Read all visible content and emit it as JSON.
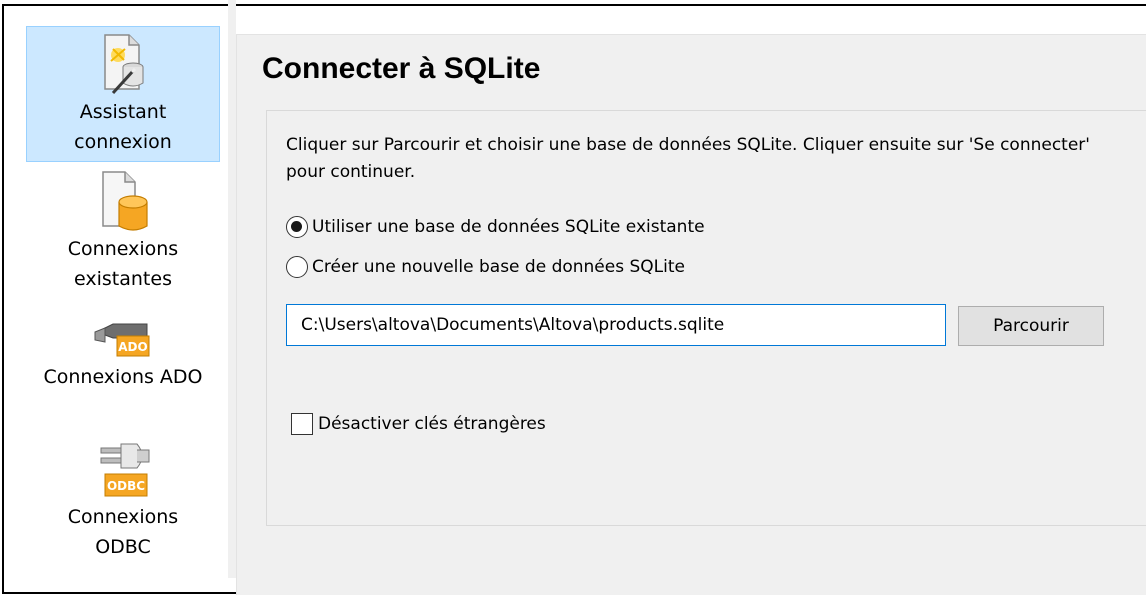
{
  "sidebar": {
    "items": [
      {
        "label_line1": "Assistant",
        "label_line2": "connexion",
        "icon": "connection-wizard-icon",
        "selected": true
      },
      {
        "label_line1": "Connexions",
        "label_line2": "existantes",
        "icon": "existing-connections-icon",
        "selected": false
      },
      {
        "label_line1": "Connexions ADO",
        "label_line2": "",
        "icon": "ado-icon",
        "selected": false
      },
      {
        "label_line1": "Connexions",
        "label_line2": "ODBC",
        "icon": "odbc-icon",
        "selected": false
      }
    ],
    "ado_icon_text": "ADO",
    "odbc_icon_text": "ODBC"
  },
  "main": {
    "title": "Connecter à SQLite",
    "instructions": "Cliquer sur Parcourir et choisir une base de données SQLite. Cliquer ensuite sur 'Se connecter' pour continuer.",
    "options": [
      {
        "label": "Utiliser une base de données SQLite existante",
        "checked": true
      },
      {
        "label": "Créer une nouvelle base de données SQLite",
        "checked": false
      }
    ],
    "path_value": "C:\\Users\\altova\\Documents\\Altova\\products.sqlite",
    "browse_label": "Parcourir",
    "foreign_keys_label": "Désactiver clés étrangères",
    "foreign_keys_checked": false
  },
  "colors": {
    "selected_bg": "#cce8ff",
    "selected_border": "#99d1ff",
    "input_focus_border": "#0078d7",
    "panel_bg": "#f0f0f0"
  }
}
